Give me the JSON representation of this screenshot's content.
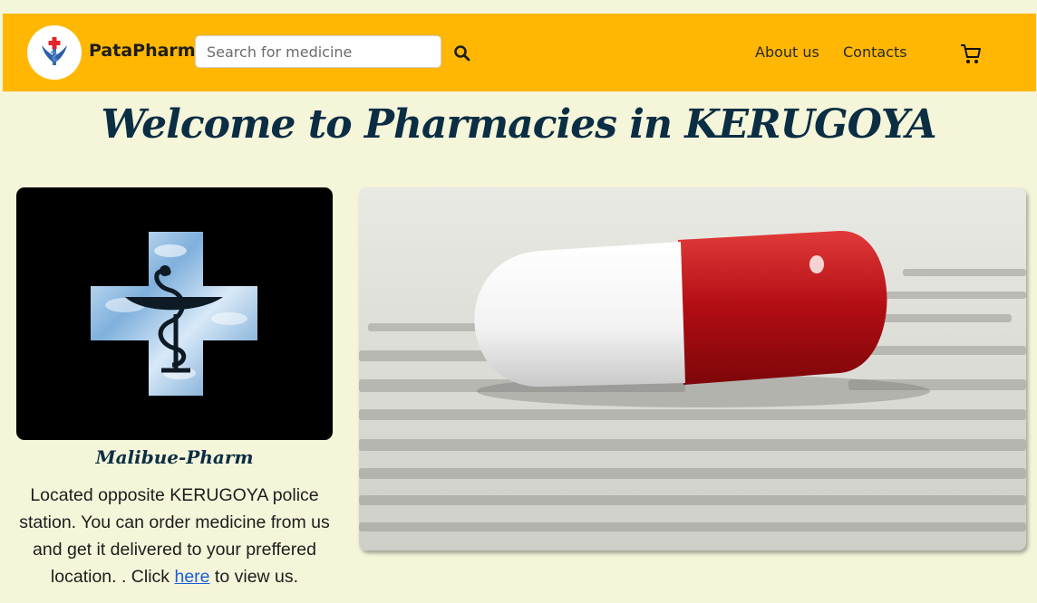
{
  "navbar": {
    "brand": "PataPharm",
    "search_placeholder": "Search for medicine",
    "links": {
      "about": "About us",
      "contacts": "Contacts"
    }
  },
  "page": {
    "title": "Welcome to Pharmacies in KERUGOYA"
  },
  "pharmacy": {
    "name": "Malibue-Pharm",
    "description_before": "Located opposite KERUGOYA police station. You can order medicine from us and get it delivered to your preffered location. . Click ",
    "link_text": "here",
    "description_after": " to view us."
  },
  "colors": {
    "navbar": "#ffb703",
    "background": "#f5f5da",
    "heading": "#0b2e44",
    "link": "#1a5fd6"
  },
  "icons": {
    "search": "search-icon",
    "cart": "cart-icon",
    "logo": "caduceus-icon"
  }
}
